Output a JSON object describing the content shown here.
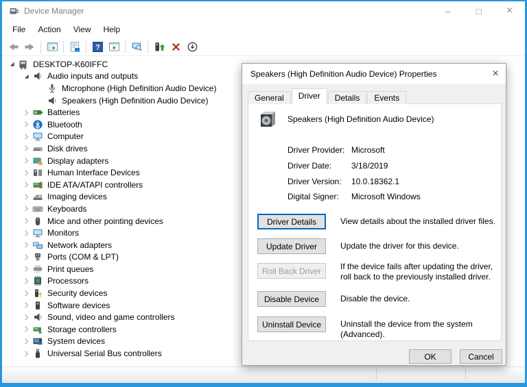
{
  "window": {
    "title": "Device Manager",
    "minimize_glyph": "–",
    "maximize_glyph": "□",
    "close_glyph": "×"
  },
  "menu": {
    "items": [
      "File",
      "Action",
      "View",
      "Help"
    ]
  },
  "toolbar": {
    "buttons": [
      "back",
      "forward",
      "separator",
      "console-tree",
      "separator",
      "properties",
      "separator",
      "help",
      "action-pane",
      "separator",
      "scan-hardware",
      "separator",
      "update-driver",
      "uninstall",
      "disable"
    ]
  },
  "tree": {
    "items": [
      {
        "label": "DESKTOP-K60IFFC",
        "icon": "pc",
        "level": 0,
        "state": "expanded"
      },
      {
        "label": "Audio inputs and outputs",
        "icon": "speaker",
        "level": 1,
        "state": "expanded"
      },
      {
        "label": "Microphone (High Definition Audio Device)",
        "icon": "microphone",
        "level": 2,
        "state": "none"
      },
      {
        "label": "Speakers (High Definition Audio Device)",
        "icon": "speaker",
        "level": 2,
        "state": "none"
      },
      {
        "label": "Batteries",
        "icon": "battery",
        "level": 1,
        "state": "collapsed"
      },
      {
        "label": "Bluetooth",
        "icon": "bluetooth",
        "level": 1,
        "state": "collapsed"
      },
      {
        "label": "Computer",
        "icon": "monitor",
        "level": 1,
        "state": "collapsed"
      },
      {
        "label": "Disk drives",
        "icon": "disk",
        "level": 1,
        "state": "collapsed"
      },
      {
        "label": "Display adapters",
        "icon": "display",
        "level": 1,
        "state": "collapsed"
      },
      {
        "label": "Human Interface Devices",
        "icon": "hid",
        "level": 1,
        "state": "collapsed"
      },
      {
        "label": "IDE ATA/ATAPI controllers",
        "icon": "ide",
        "level": 1,
        "state": "collapsed"
      },
      {
        "label": "Imaging devices",
        "icon": "imaging",
        "level": 1,
        "state": "collapsed"
      },
      {
        "label": "Keyboards",
        "icon": "keyboard",
        "level": 1,
        "state": "collapsed"
      },
      {
        "label": "Mice and other pointing devices",
        "icon": "mouse",
        "level": 1,
        "state": "collapsed"
      },
      {
        "label": "Monitors",
        "icon": "monitor",
        "level": 1,
        "state": "collapsed"
      },
      {
        "label": "Network adapters",
        "icon": "network",
        "level": 1,
        "state": "collapsed"
      },
      {
        "label": "Ports (COM & LPT)",
        "icon": "ports",
        "level": 1,
        "state": "collapsed"
      },
      {
        "label": "Print queues",
        "icon": "printer",
        "level": 1,
        "state": "collapsed"
      },
      {
        "label": "Processors",
        "icon": "processor",
        "level": 1,
        "state": "collapsed"
      },
      {
        "label": "Security devices",
        "icon": "security",
        "level": 1,
        "state": "collapsed"
      },
      {
        "label": "Software devices",
        "icon": "software",
        "level": 1,
        "state": "collapsed"
      },
      {
        "label": "Sound, video and game controllers",
        "icon": "speaker",
        "level": 1,
        "state": "collapsed"
      },
      {
        "label": "Storage controllers",
        "icon": "storage",
        "level": 1,
        "state": "collapsed"
      },
      {
        "label": "System devices",
        "icon": "system",
        "level": 1,
        "state": "collapsed"
      },
      {
        "label": "Universal Serial Bus controllers",
        "icon": "usb",
        "level": 1,
        "state": "collapsed"
      }
    ]
  },
  "dialog": {
    "title": "Speakers (High Definition Audio Device) Properties",
    "close_glyph": "×",
    "tabs": [
      {
        "label": "General",
        "active": false
      },
      {
        "label": "Driver",
        "active": true
      },
      {
        "label": "Details",
        "active": false
      },
      {
        "label": "Events",
        "active": false
      }
    ],
    "device_name": "Speakers (High Definition Audio Device)",
    "info_rows": [
      {
        "label": "Driver Provider:",
        "value": "Microsoft"
      },
      {
        "label": "Driver Date:",
        "value": "3/18/2019"
      },
      {
        "label": "Driver Version:",
        "value": "10.0.18362.1"
      },
      {
        "label": "Digital Signer:",
        "value": "Microsoft Windows"
      }
    ],
    "actions": [
      {
        "button": "Driver Details",
        "description": "View details about the installed driver files.",
        "state": "focused"
      },
      {
        "button": "Update Driver",
        "description": "Update the driver for this device.",
        "state": "normal"
      },
      {
        "button": "Roll Back Driver",
        "description": "If the device fails after updating the driver, roll back to the previously installed driver.",
        "state": "disabled"
      },
      {
        "button": "Disable Device",
        "description": "Disable the device.",
        "state": "normal"
      },
      {
        "button": "Uninstall Device",
        "description": "Uninstall the device from the system (Advanced).",
        "state": "normal"
      }
    ],
    "ok_label": "OK",
    "cancel_label": "Cancel"
  },
  "colors": {
    "window_border": "#2a96dc",
    "focus_border": "#0067c0",
    "disabled_text": "#9d9d9d",
    "uninstall_red": "#c42b1c"
  }
}
